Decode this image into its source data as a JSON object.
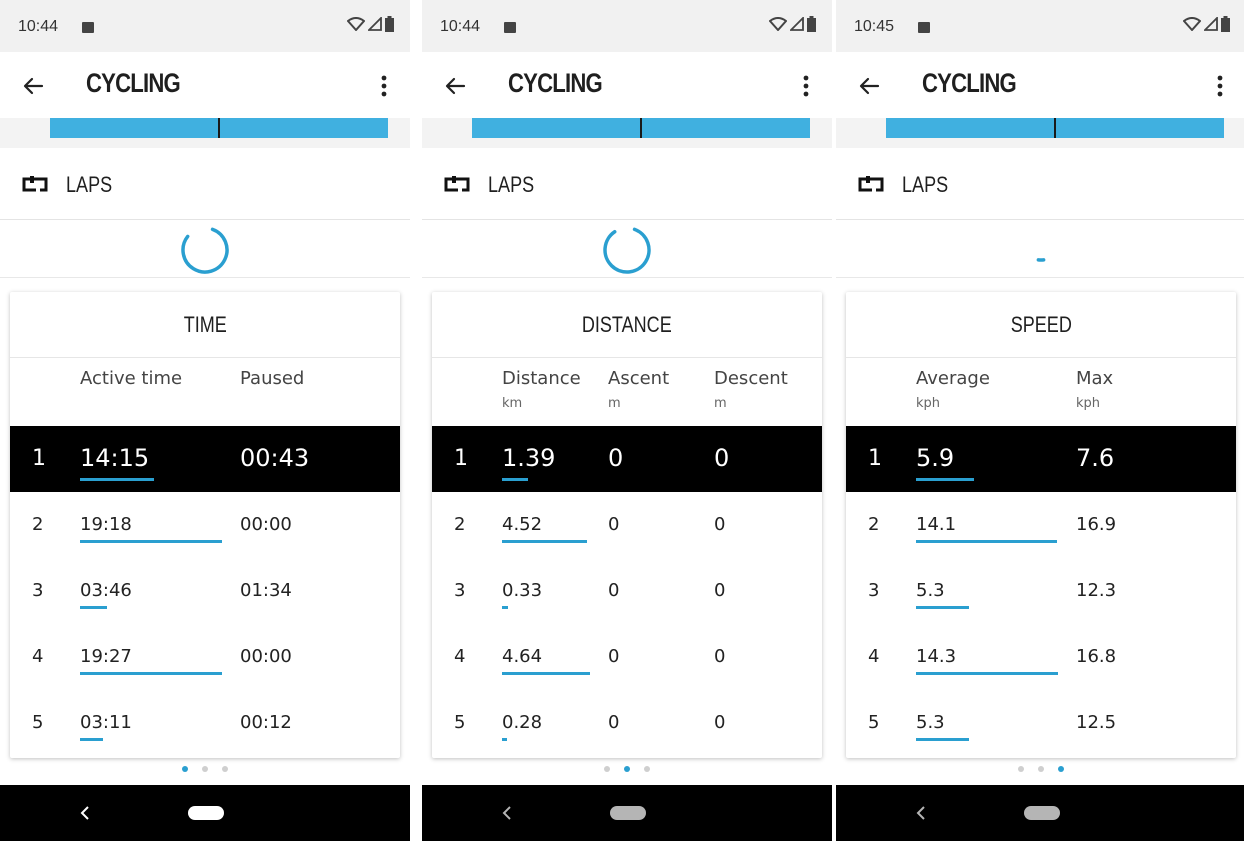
{
  "screens": [
    {
      "status_time": "10:44",
      "app_title": "CYCLING",
      "laps_label": "LAPS",
      "card_title": "TIME",
      "gauge_fraction": 0.8,
      "columns": [
        {
          "label": "Active time",
          "unit": ""
        },
        {
          "label": "Paused",
          "unit": ""
        }
      ],
      "rows": [
        {
          "num": "1",
          "cells": [
            "14:15",
            "00:43"
          ],
          "bar_fraction": 0.52,
          "selected": true
        },
        {
          "num": "2",
          "cells": [
            "19:18",
            "00:00"
          ],
          "bar_fraction": 1.0,
          "selected": false
        },
        {
          "num": "3",
          "cells": [
            "03:46",
            "01:34"
          ],
          "bar_fraction": 0.19,
          "selected": false
        },
        {
          "num": "4",
          "cells": [
            "19:27",
            "00:00"
          ],
          "bar_fraction": 1.0,
          "selected": false
        },
        {
          "num": "5",
          "cells": [
            "03:11",
            "00:12"
          ],
          "bar_fraction": 0.16,
          "selected": false
        }
      ],
      "active_page": 0
    },
    {
      "status_time": "10:44",
      "app_title": "CYCLING",
      "laps_label": "LAPS",
      "card_title": "DISTANCE",
      "gauge_fraction": 0.85,
      "columns": [
        {
          "label": "Distance",
          "unit": "km"
        },
        {
          "label": "Ascent",
          "unit": "m"
        },
        {
          "label": "Descent",
          "unit": "m"
        }
      ],
      "rows": [
        {
          "num": "1",
          "cells": [
            "1.39",
            "0",
            "0"
          ],
          "bar_fraction": 0.3,
          "selected": true
        },
        {
          "num": "2",
          "cells": [
            "4.52",
            "0",
            "0"
          ],
          "bar_fraction": 0.97,
          "selected": false
        },
        {
          "num": "3",
          "cells": [
            "0.33",
            "0",
            "0"
          ],
          "bar_fraction": 0.07,
          "selected": false
        },
        {
          "num": "4",
          "cells": [
            "4.64",
            "0",
            "0"
          ],
          "bar_fraction": 1.0,
          "selected": false
        },
        {
          "num": "5",
          "cells": [
            "0.28",
            "0",
            "0"
          ],
          "bar_fraction": 0.06,
          "selected": false
        }
      ],
      "active_page": 1
    },
    {
      "status_time": "10:45",
      "app_title": "CYCLING",
      "laps_label": "LAPS",
      "card_title": "SPEED",
      "gauge_fraction": 0.04,
      "columns": [
        {
          "label": "Average",
          "unit": "kph"
        },
        {
          "label": "Max",
          "unit": "kph"
        }
      ],
      "rows": [
        {
          "num": "1",
          "cells": [
            "5.9",
            "7.6"
          ],
          "bar_fraction": 0.41,
          "selected": true
        },
        {
          "num": "2",
          "cells": [
            "14.1",
            "16.9"
          ],
          "bar_fraction": 0.99,
          "selected": false
        },
        {
          "num": "3",
          "cells": [
            "5.3",
            "12.3"
          ],
          "bar_fraction": 0.37,
          "selected": false
        },
        {
          "num": "4",
          "cells": [
            "14.3",
            "16.8"
          ],
          "bar_fraction": 1.0,
          "selected": false
        },
        {
          "num": "5",
          "cells": [
            "5.3",
            "12.5"
          ],
          "bar_fraction": 0.37,
          "selected": false
        }
      ],
      "active_page": 2
    }
  ],
  "colors": {
    "accent": "#2a9fd0",
    "topbar": "#40b0e0",
    "selected_row": "#000000"
  },
  "icons": [
    "back-arrow-icon",
    "more-vert-icon",
    "laps-icon",
    "wifi-icon",
    "signal-icon",
    "battery-icon",
    "image-icon",
    "nav-back-icon",
    "nav-home-pill"
  ]
}
